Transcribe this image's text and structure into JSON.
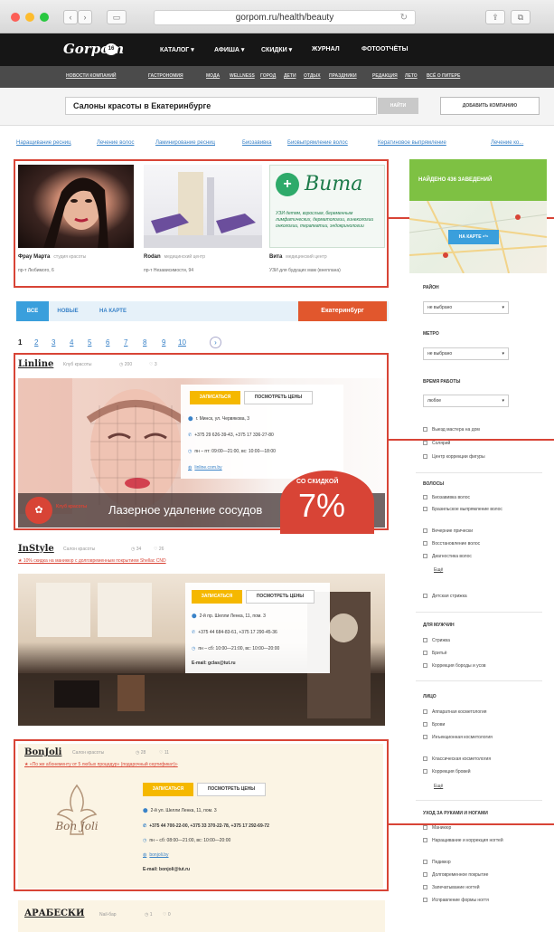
{
  "browser": {
    "url": "gorpom.ru/health/beauty",
    "nav_back": "‹",
    "nav_fwd": "›"
  },
  "site": {
    "logo": "Gorpom",
    "logo_badge": "16",
    "nav": [
      "КАТАЛОГ ▾",
      "АФИША ▾",
      "СКИДКИ ▾",
      "ЖУРНАЛ",
      "ФОТООТЧЁТЫ"
    ],
    "subnav": [
      "НОВОСТИ КОМПАНИЙ",
      "ГАСТРОНОМИЯ",
      "МОДА",
      "WELLNESS",
      "ГОРОД",
      "ДЕТИ",
      "ОТДЫХ",
      "ПРАЗДНИКИ",
      "РЕДАКЦИЯ",
      "ЛЕТО",
      "ВСЁ О ПИТЕРЕ"
    ]
  },
  "search": {
    "value": "Салоны красоты в Екатеринбурге",
    "button": "НАЙТИ",
    "add_company": "ДОБАВИТЬ КОМПАНИЮ"
  },
  "categories": [
    "Наращивание ресниц",
    "Лечение волос",
    "Ламинирование ресниц",
    "Биозавивка",
    "Биовыпрямление волос",
    "Кератиновое выпрямление",
    "Лечение ко..."
  ],
  "featured": [
    {
      "name": "Фрау Марта",
      "type": "студия красоты",
      "addr": "пр-т Любимого, 6"
    },
    {
      "name": "Rodan",
      "type": "медицинский центр",
      "addr": "пр-т Независимости, 94"
    },
    {
      "name": "Вита",
      "type": "медицинский центр",
      "addr": "УЗИ для будущих мам (внеплана)"
    }
  ],
  "vita_logo": "Вита",
  "vita_text": "УЗИ детям, взрослым, беременным\nлимфатических, дерматологии, гинекологии\nонкологии, терапевтии, эндокринологии",
  "filter_tabs": [
    "ВСЕ",
    "НОВЫЕ",
    "НА КАРТЕ"
  ],
  "city_button": "Екатеринбург",
  "pages": [
    "1",
    "2",
    "3",
    "4",
    "5",
    "6",
    "7",
    "8",
    "9",
    "10"
  ],
  "page_next": "›",
  "listings": {
    "linline": {
      "title": "Linline",
      "type": "Клуб красоты",
      "views": "◷ 200",
      "comments": "♡ 3",
      "signup": "ЗАПИСАТЬСЯ",
      "prices": "ПОСМОТРЕТЬ ЦЕНЫ",
      "address": "г. Минск, ул. Червякова, 3",
      "phone": "+375 29 626-39-43, +375 17 336-27-80",
      "hours": "пн – пт: 09:00—21:00, вс: 10:00—18:00",
      "site": "linline.com.by",
      "banner_left": "Клуб красоты",
      "banner": "Лазерное удаление сосудов",
      "discount_label": "СО СКИДКОЙ",
      "discount": "7%"
    },
    "instyle": {
      "title": "InStyle",
      "type": "Салон красоты",
      "views": "◷ 34",
      "comments": "♡ 26",
      "promo": "10% скидка на маникюр с долговременным покрытием Shellac CND",
      "signup": "ЗАПИСАТЬСЯ",
      "prices": "ПОСМОТРЕТЬ ЦЕНЫ",
      "address": "2-й пр. Шелли Ленка, 11, пом. 3",
      "phone": "+375 44 684-83-61, +375 17 290-45-36",
      "hours": "пн – сб: 10:00—21:00, вс: 10:00—20:00",
      "email": "E-mail: gclas@tut.ru"
    },
    "bonjoli": {
      "title": "BonJoli",
      "type": "Салон красоты",
      "views": "◷ 28",
      "comments": "♡ 11",
      "promo": "«По же абонементу от 5 любых процедур» (подарочный сертификат)»",
      "signup": "ЗАПИСАТЬСЯ",
      "prices": "ПОСМОТРЕТЬ ЦЕНЫ",
      "address": "2-й ул. Шелли Ленка, 11, пом. 3",
      "phone": "+375 44 700-22-00, +375 33 370-22-78, +375 17 292-69-72",
      "hours": "пн – сб: 08:00—21:00, вс: 10:00—20:00",
      "site": "bonjoli.by",
      "email": "E-mail: bonjoli@tut.ru",
      "logo": "Bon Joli"
    },
    "arabeski": {
      "title": "АРАБЕСКИ",
      "type": "Nail-бар",
      "views": "◷ 1",
      "comments": "♡ 0"
    }
  },
  "sidebar": {
    "find": "НАЙДЕНО 436 ЗАВЕДЕНИЙ",
    "map_button": "НА КАРТЕ ⁴³⁶",
    "district_label": "РАЙОН",
    "district_value": "не выбрано",
    "metro_label": "МЕТРО",
    "metro_value": "не выбрано",
    "hours_label": "ВРЕМЯ РАБОТЫ",
    "hours_value": "любое",
    "checks1": [
      "Выезд мастера на дом",
      "Солярий",
      "Центр коррекции фигуры"
    ],
    "hair_label": "ВОЛОСЫ",
    "hair": [
      "Биозавивка волос",
      "Бразильское выпрямление волос",
      "Вечерние прически",
      "Восстановление волос",
      "Диагностика волос"
    ],
    "more": "Ещё",
    "kids": "Детская стрижка",
    "men_label": "ДЛЯ МУЖЧИН",
    "men": [
      "Стрижка",
      "Бритьё",
      "Коррекция бороды и усов"
    ],
    "face_label": "ЛИЦО",
    "face": [
      "Аппаратная косметология",
      "Брови",
      "Инъекционная косметология",
      "Классическая косметология",
      "Коррекция бровей"
    ],
    "nails_label": "УХОД ЗА РУКАМИ И НОГАМИ",
    "nails": [
      "Маникюр",
      "Наращивание и коррекция ногтей",
      "Педикюр",
      "Долговременное покрытие",
      "Запечатывание ногтей",
      "Исправление формы ногтя"
    ]
  }
}
